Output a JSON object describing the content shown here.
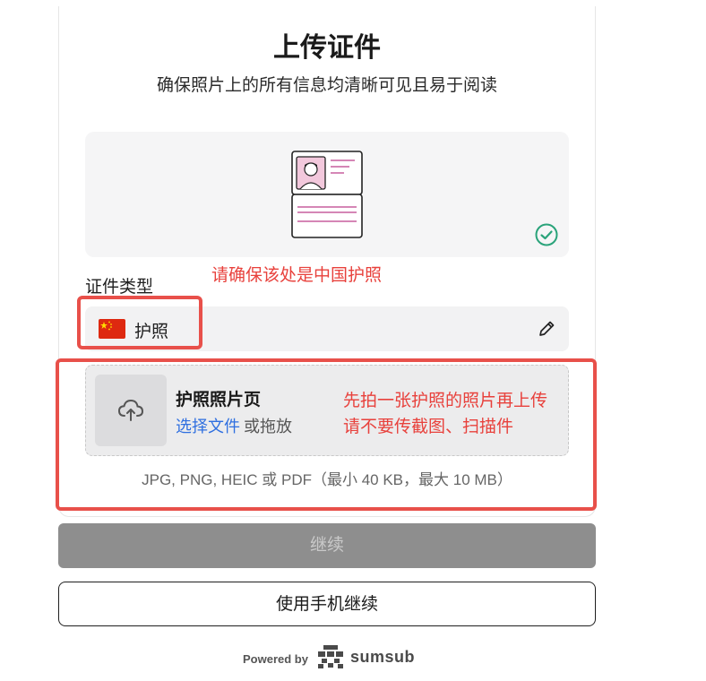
{
  "header": {
    "title": "上传证件",
    "subtitle": "确保照片上的所有信息均清晰可见且易于阅读"
  },
  "document": {
    "label": "证件类型",
    "selected": "护照",
    "flag": "china-flag-icon"
  },
  "annotations": {
    "doc_type_note": "请确保该处是中国护照",
    "upload_note_line1": "先拍一张护照的照片再上传",
    "upload_note_line2": "请不要传截图、扫描件"
  },
  "upload": {
    "title": "护照照片页",
    "choose_file": "选择文件",
    "or_drag": "或拖放",
    "formats": "JPG, PNG, HEIC 或 PDF（最小 40 KB，最大 10 MB）"
  },
  "buttons": {
    "continue": "继续",
    "continue_on_phone": "使用手机继续"
  },
  "footer": {
    "powered_by": "Powered by",
    "brand": "sumsub"
  },
  "colors": {
    "annotation_red": "#e8413c",
    "link_blue": "#2f6fe0",
    "check_green": "#2aa37a",
    "disabled_button": "#8e8e8e"
  }
}
